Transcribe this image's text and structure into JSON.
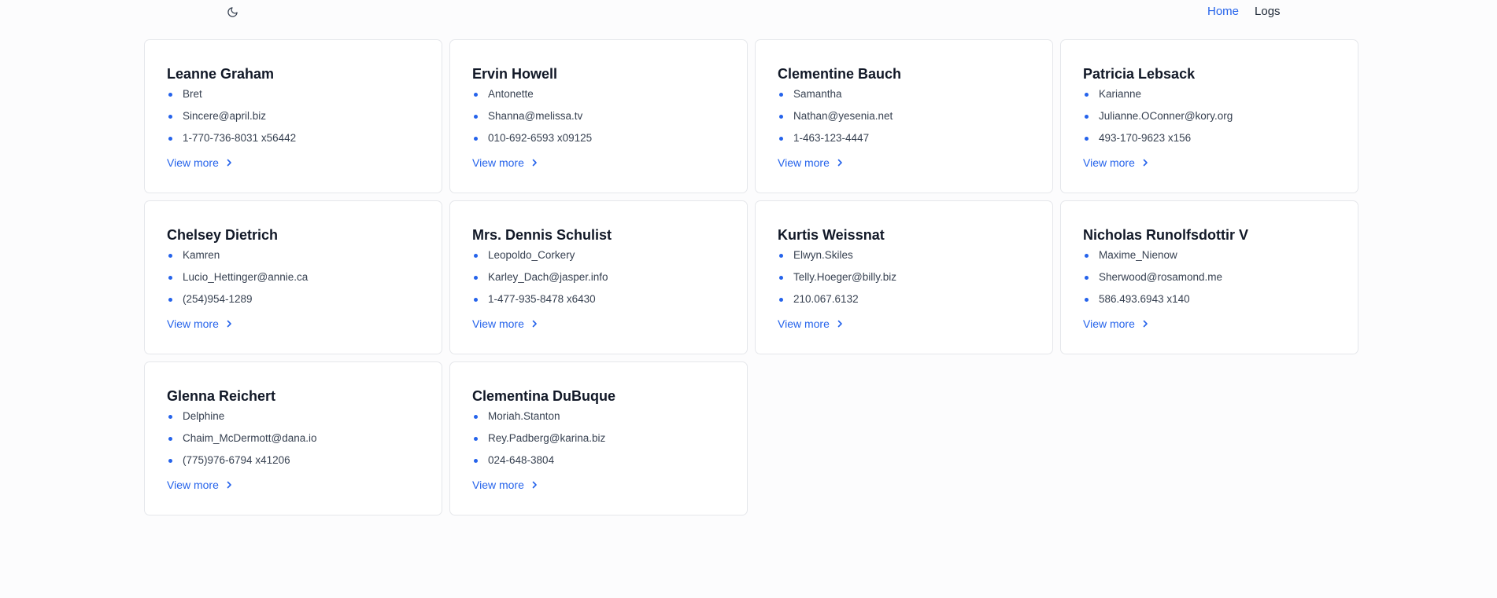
{
  "header": {
    "theme_icon": "moon-icon",
    "nav": {
      "home_label": "Home",
      "logs_label": "Logs"
    }
  },
  "users": [
    {
      "name": "Leanne Graham",
      "username": "Bret",
      "email": "Sincere@april.biz",
      "phone": "1-770-736-8031 x56442",
      "link_label": "View more"
    },
    {
      "name": "Ervin Howell",
      "username": "Antonette",
      "email": "Shanna@melissa.tv",
      "phone": "010-692-6593 x09125",
      "link_label": "View more"
    },
    {
      "name": "Clementine Bauch",
      "username": "Samantha",
      "email": "Nathan@yesenia.net",
      "phone": "1-463-123-4447",
      "link_label": "View more"
    },
    {
      "name": "Patricia Lebsack",
      "username": "Karianne",
      "email": "Julianne.OConner@kory.org",
      "phone": "493-170-9623 x156",
      "link_label": "View more"
    },
    {
      "name": "Chelsey Dietrich",
      "username": "Kamren",
      "email": "Lucio_Hettinger@annie.ca",
      "phone": "(254)954-1289",
      "link_label": "View more"
    },
    {
      "name": "Mrs. Dennis Schulist",
      "username": "Leopoldo_Corkery",
      "email": "Karley_Dach@jasper.info",
      "phone": "1-477-935-8478 x6430",
      "link_label": "View more"
    },
    {
      "name": "Kurtis Weissnat",
      "username": "Elwyn.Skiles",
      "email": "Telly.Hoeger@billy.biz",
      "phone": "210.067.6132",
      "link_label": "View more"
    },
    {
      "name": "Nicholas Runolfsdottir V",
      "username": "Maxime_Nienow",
      "email": "Sherwood@rosamond.me",
      "phone": "586.493.6943 x140",
      "link_label": "View more"
    },
    {
      "name": "Glenna Reichert",
      "username": "Delphine",
      "email": "Chaim_McDermott@dana.io",
      "phone": "(775)976-6794 x41206",
      "link_label": "View more"
    },
    {
      "name": "Clementina DuBuque",
      "username": "Moriah.Stanton",
      "email": "Rey.Padberg@karina.biz",
      "phone": "024-648-3804",
      "link_label": "View more"
    }
  ],
  "colors": {
    "accent": "#2563eb",
    "text": "#111827",
    "border": "#e5e7eb"
  }
}
